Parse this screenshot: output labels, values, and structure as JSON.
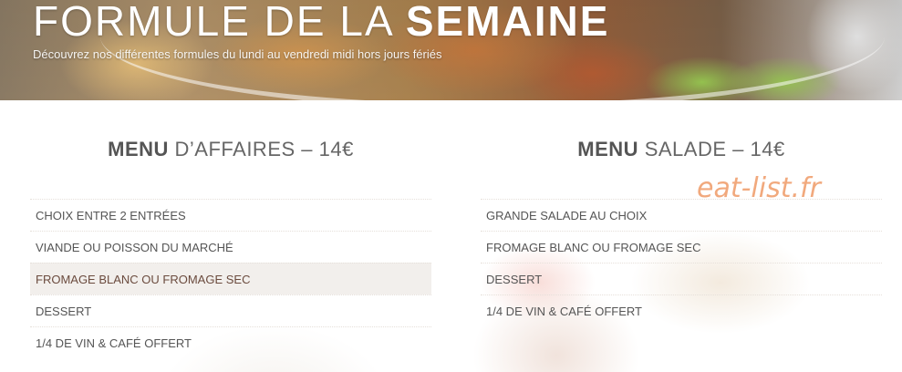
{
  "hero": {
    "title_light": "FORMULE DE LA ",
    "title_bold": "SEMAINE",
    "subtitle": "Découvrez nos différentes formules du lundi au vendredi midi hors jours fériés"
  },
  "menus": [
    {
      "heading_bold": "MENU",
      "heading_rest": " D’AFFAIRES – 14€",
      "items": [
        "CHOIX ENTRE 2 ENTRÉES",
        "VIANDE OU POISSON DU MARCHÉ",
        "FROMAGE BLANC OU FROMAGE SEC",
        "DESSERT",
        "1/4 DE VIN & CAFÉ OFFERT"
      ]
    },
    {
      "heading_bold": "MENU",
      "heading_rest": " SALADE – 14€",
      "items": [
        "GRANDE SALADE AU CHOIX",
        "FROMAGE BLANC OU FROMAGE SEC",
        "DESSERT",
        "1/4 DE VIN & CAFÉ OFFERT"
      ]
    }
  ],
  "watermark": "eat-list.fr"
}
